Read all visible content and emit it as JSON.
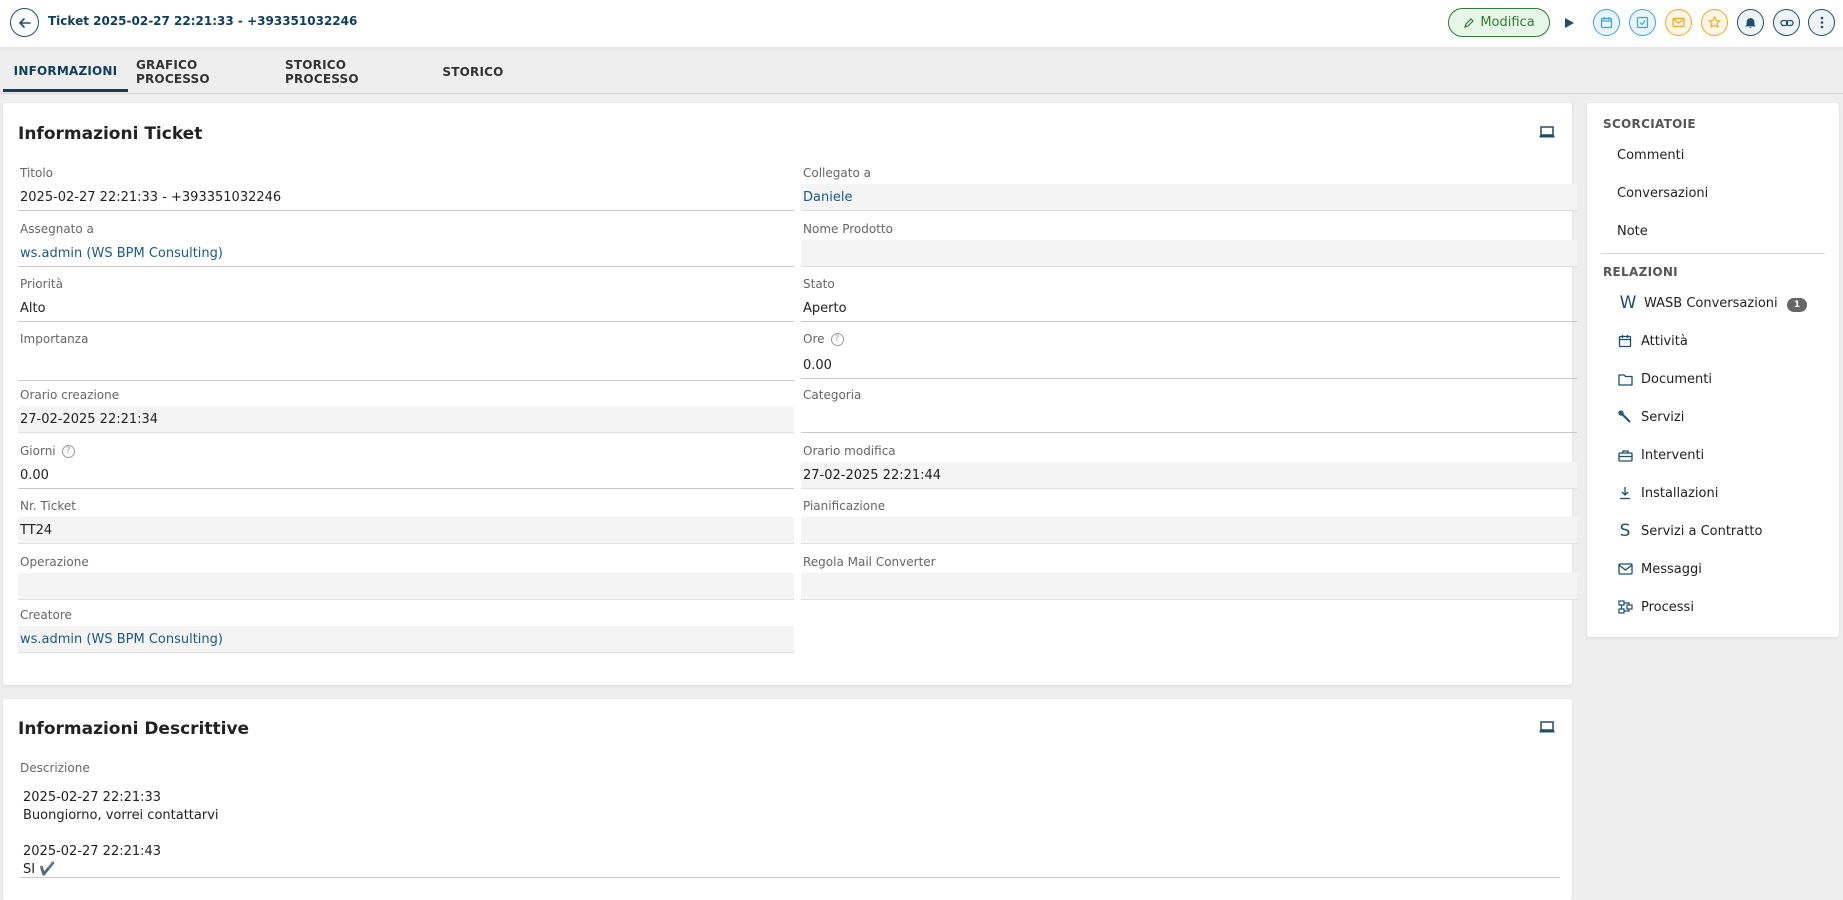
{
  "header": {
    "title": "Ticket 2025-02-27 22:21:33 - +393351032246",
    "modifica_label": "Modifica"
  },
  "tabs": [
    {
      "label": "INFORMAZIONI",
      "active": true
    },
    {
      "label": "GRAFICO PROCESSO",
      "active": false
    },
    {
      "label": "STORICO PROCESSO",
      "active": false
    },
    {
      "label": "STORICO",
      "active": false
    }
  ],
  "ticket_info": {
    "title": "Informazioni Ticket",
    "left": [
      {
        "label": "Titolo",
        "value": "2025-02-27 22:21:33 - +393351032246"
      },
      {
        "label": "Assegnato a",
        "value": "ws.admin (WS BPM Consulting)"
      },
      {
        "label": "Priorità",
        "value": "Alto"
      },
      {
        "label": "Importanza",
        "value": ""
      },
      {
        "label": "Orario creazione",
        "value": "27-02-2025 22:21:34"
      },
      {
        "label": "Giorni",
        "value": "0.00"
      },
      {
        "label": "Nr. Ticket",
        "value": "TT24"
      },
      {
        "label": "Operazione",
        "value": ""
      },
      {
        "label": "Creatore",
        "value": "ws.admin (WS BPM Consulting)"
      }
    ],
    "right": [
      {
        "label": "Collegato a",
        "value": "Daniele"
      },
      {
        "label": "Nome Prodotto",
        "value": ""
      },
      {
        "label": "Stato",
        "value": "Aperto"
      },
      {
        "label": "Ore",
        "value": "0.00"
      },
      {
        "label": "Categoria",
        "value": ""
      },
      {
        "label": "Orario modifica",
        "value": "27-02-2025 22:21:44"
      },
      {
        "label": "Pianificazione",
        "value": ""
      },
      {
        "label": "Regola Mail Converter",
        "value": ""
      }
    ]
  },
  "descriptive_info": {
    "title": "Informazioni Descrittive",
    "label": "Descrizione",
    "text": "2025-02-27 22:21:33\nBuongiorno, vorrei contattarvi\n\n2025-02-27 22:21:43\nSI ✔️"
  },
  "sidebar": {
    "shortcuts_heading": "SCORCIATOIE",
    "shortcuts": [
      "Commenti",
      "Conversazioni",
      "Note"
    ],
    "relations_heading": "RELAZIONI",
    "relations": [
      {
        "label": "WASB Conversazioni",
        "icon": "w-letter-icon",
        "count": "1"
      },
      {
        "label": "Attività",
        "icon": "calendar-icon"
      },
      {
        "label": "Documenti",
        "icon": "folder-icon"
      },
      {
        "label": "Servizi",
        "icon": "wrench-icon"
      },
      {
        "label": "Interventi",
        "icon": "toolbox-icon"
      },
      {
        "label": "Installazioni",
        "icon": "download-icon"
      },
      {
        "label": "Servizi a Contratto",
        "icon": "s-letter-icon"
      },
      {
        "label": "Messaggi",
        "icon": "mail-icon"
      },
      {
        "label": "Processi",
        "icon": "process-icon"
      }
    ]
  },
  "colors": {
    "primary": "#0f3d5c",
    "link": "#1a5a84",
    "success": "#2e7d32",
    "info": "#3ba3dc",
    "warning": "#f5a623"
  }
}
